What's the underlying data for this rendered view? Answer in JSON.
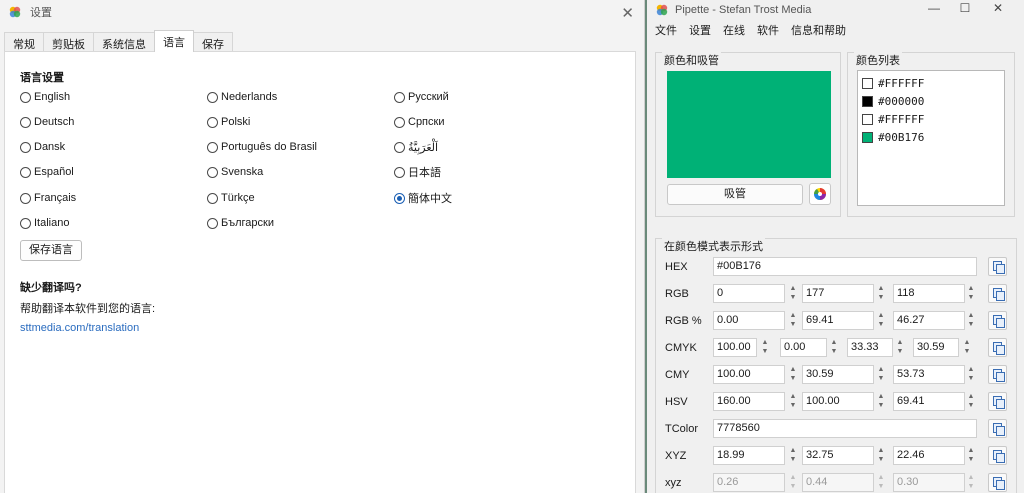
{
  "settings": {
    "title": "设置",
    "tabs": [
      {
        "label": "常规"
      },
      {
        "label": "剪贴板"
      },
      {
        "label": "系统信息"
      },
      {
        "label": "语言"
      },
      {
        "label": "保存"
      }
    ],
    "active_tab": "语言",
    "section_title": "语言设置",
    "languages": [
      {
        "label": "English",
        "checked": false
      },
      {
        "label": "Deutsch",
        "checked": false
      },
      {
        "label": "Dansk",
        "checked": false
      },
      {
        "label": "Español",
        "checked": false
      },
      {
        "label": "Français",
        "checked": false
      },
      {
        "label": "Italiano",
        "checked": false
      },
      {
        "label": "Nederlands",
        "checked": false
      },
      {
        "label": "Polski",
        "checked": false
      },
      {
        "label": "Português do Brasil",
        "checked": false
      },
      {
        "label": "Svenska",
        "checked": false
      },
      {
        "label": "Türkçe",
        "checked": false
      },
      {
        "label": "Български",
        "checked": false
      },
      {
        "label": "Русский",
        "checked": false
      },
      {
        "label": "Српски",
        "checked": false
      },
      {
        "label": "اَلْعَرَبِيَّةُ",
        "checked": false
      },
      {
        "label": "日本語",
        "checked": false
      },
      {
        "label": "簡体中文",
        "checked": true
      }
    ],
    "save_button": "保存语言",
    "missing_title": "缺少翻译吗?",
    "help_text": "帮助翻译本软件到您的语言:",
    "help_link": "sttmedia.com/translation"
  },
  "pipette": {
    "title": "Pipette - Stefan Trost Media",
    "menu": [
      "文件",
      "设置",
      "在线",
      "软件",
      "信息和帮助"
    ],
    "color_group_title": "颜色和吸管",
    "current_color": "#00B176",
    "pick_button": "吸管",
    "list_group_title": "颜色列表",
    "color_list": [
      {
        "hex": "#FFFFFF",
        "color": "#FFFFFF"
      },
      {
        "hex": "#000000",
        "color": "#000000"
      },
      {
        "hex": "#FFFFFF",
        "color": "#FFFFFF"
      },
      {
        "hex": "#00B176",
        "color": "#00B176"
      }
    ],
    "formats_title": "在颜色模式表示形式",
    "formats": {
      "hex": {
        "label": "HEX",
        "values": [
          "#00B176"
        ]
      },
      "rgb": {
        "label": "RGB",
        "values": [
          "0",
          "177",
          "118"
        ]
      },
      "rgb_pct": {
        "label": "RGB %",
        "values": [
          "0.00",
          "69.41",
          "46.27"
        ]
      },
      "cmyk": {
        "label": "CMYK",
        "values": [
          "100.00",
          "0.00",
          "33.33",
          "30.59"
        ]
      },
      "cmy": {
        "label": "CMY",
        "values": [
          "100.00",
          "30.59",
          "53.73"
        ]
      },
      "hsv": {
        "label": "HSV",
        "values": [
          "160.00",
          "100.00",
          "69.41"
        ]
      },
      "tcolor": {
        "label": "TColor",
        "values": [
          "7778560"
        ]
      },
      "xyz": {
        "label": "XYZ",
        "values": [
          "18.99",
          "32.75",
          "22.46"
        ]
      },
      "xyz_small": {
        "label": "xyz",
        "values": [
          "0.26",
          "0.44",
          "0.30"
        ]
      }
    }
  }
}
